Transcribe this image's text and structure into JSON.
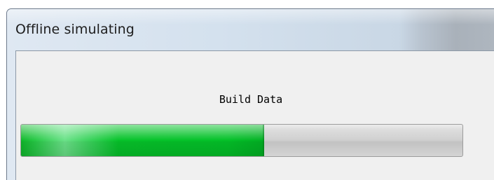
{
  "window": {
    "title": "Offline simulating"
  },
  "status": {
    "message": "Build Data"
  },
  "progress": {
    "percent": 55,
    "fill_color": "#06c32a",
    "track_color": "#cfcfcf"
  }
}
